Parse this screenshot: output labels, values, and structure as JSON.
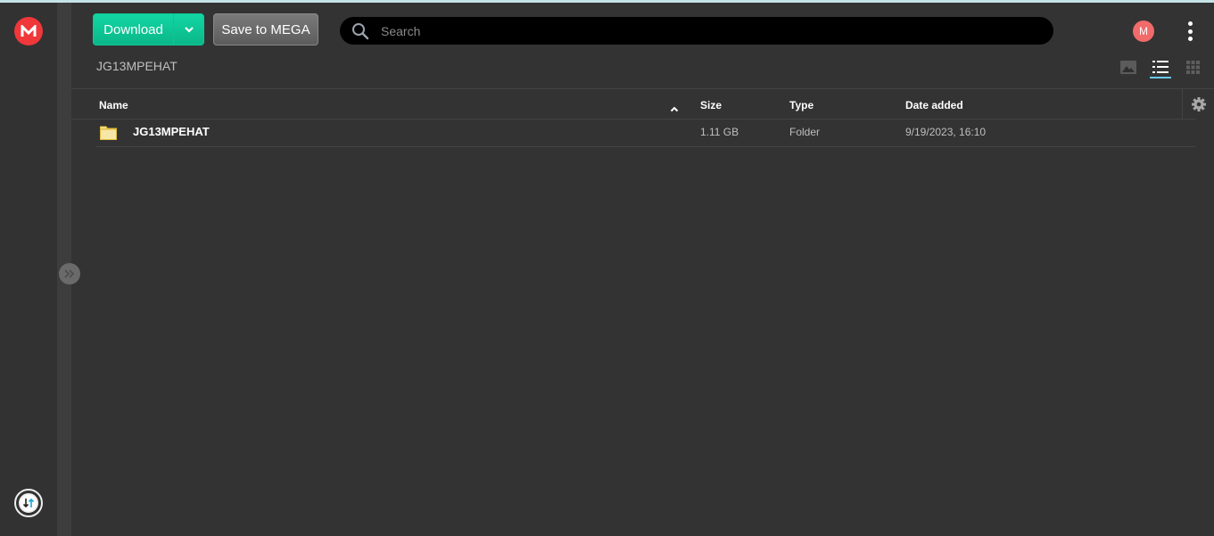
{
  "colors": {
    "accent_green": "#0fc89a",
    "brand_red": "#f0373a",
    "avatar_bg": "#f26a6a",
    "active_view_underline": "#6ac8f0",
    "folder_yellow": "#f6e2a0"
  },
  "sidebar": {
    "logo_letter": "M",
    "expand_icon": "double-chevron-right-icon",
    "transfers_icon": "transfers-arrows-icon"
  },
  "toolbar": {
    "download_label": "Download",
    "download_menu_icon": "chevron-down-icon",
    "save_label": "Save to MEGA"
  },
  "search": {
    "placeholder": "Search",
    "value": ""
  },
  "header": {
    "avatar_letter": "M",
    "menu_icon": "more-vertical-icon"
  },
  "breadcrumb": {
    "current": "JG13MPEHAT"
  },
  "view_modes": [
    {
      "name": "media-view",
      "icon": "image-icon",
      "active": false
    },
    {
      "name": "list-view",
      "icon": "list-icon",
      "active": true
    },
    {
      "name": "grid-view",
      "icon": "grid-icon",
      "active": false
    }
  ],
  "table": {
    "columns": {
      "name": "Name",
      "size": "Size",
      "type": "Type",
      "date": "Date added"
    },
    "sort_icon": "chevron-up-icon",
    "settings_icon": "gear-icon",
    "rows": [
      {
        "icon": "folder-icon",
        "name": "JG13MPEHAT",
        "size": "1.11 GB",
        "type": "Folder",
        "date": "9/19/2023, 16:10"
      }
    ]
  }
}
